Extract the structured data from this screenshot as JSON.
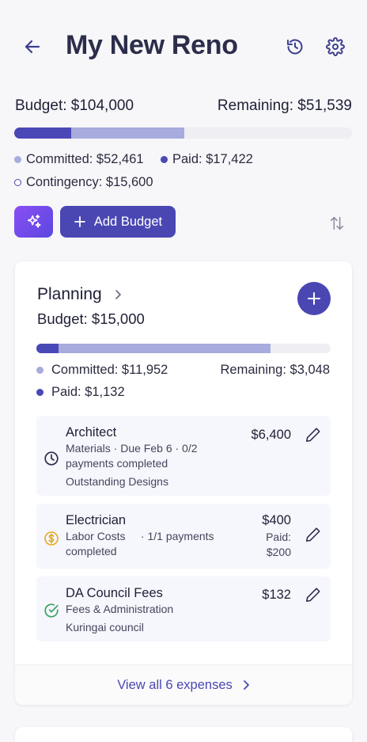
{
  "header": {
    "title": "My New Reno"
  },
  "summary": {
    "budget": "Budget: $104,000",
    "remaining": "Remaining: $51,539",
    "committed": "Committed: $52,461",
    "paid": "Paid: $17,422",
    "contingency": "Contingency: $15,600",
    "progress": {
      "paid_fraction": 0.168,
      "committed_fraction": 0.504
    }
  },
  "actions": {
    "add_budget_label": "Add Budget"
  },
  "category": {
    "title": "Planning",
    "budget": "Budget: $15,000",
    "committed": "Committed: $11,952",
    "remaining": "Remaining: $3,048",
    "paid": "Paid: $1,132",
    "progress": {
      "paid_fraction": 0.075,
      "committed_fraction": 0.797
    },
    "expenses": [
      {
        "name": "Architect",
        "meta_line1": "Materials · Due Feb 6   · 0/2",
        "meta_line2": "payments completed",
        "note": "Outstanding Designs",
        "amount": "$6,400",
        "status_icon": "clock-icon"
      },
      {
        "name": "Electrician",
        "meta_line1": "Labor Costs     · 1/1 payments",
        "meta_line2": "completed",
        "amount": "$400",
        "paid_line1": "Paid:",
        "paid_line2": "$200",
        "status_icon": "dollar-circle-icon"
      },
      {
        "name": "DA Council Fees",
        "meta_line1": "Fees & Administration",
        "note": "Kuringai council",
        "amount": "$132",
        "status_icon": "check-circle-icon"
      }
    ],
    "view_all": "View all 6 expenses"
  },
  "colors": {
    "primary": "#4a47b3",
    "committed": "#a7abdd",
    "track": "#eeeef3",
    "warning": "#e6a91c",
    "success": "#3aa35f"
  }
}
